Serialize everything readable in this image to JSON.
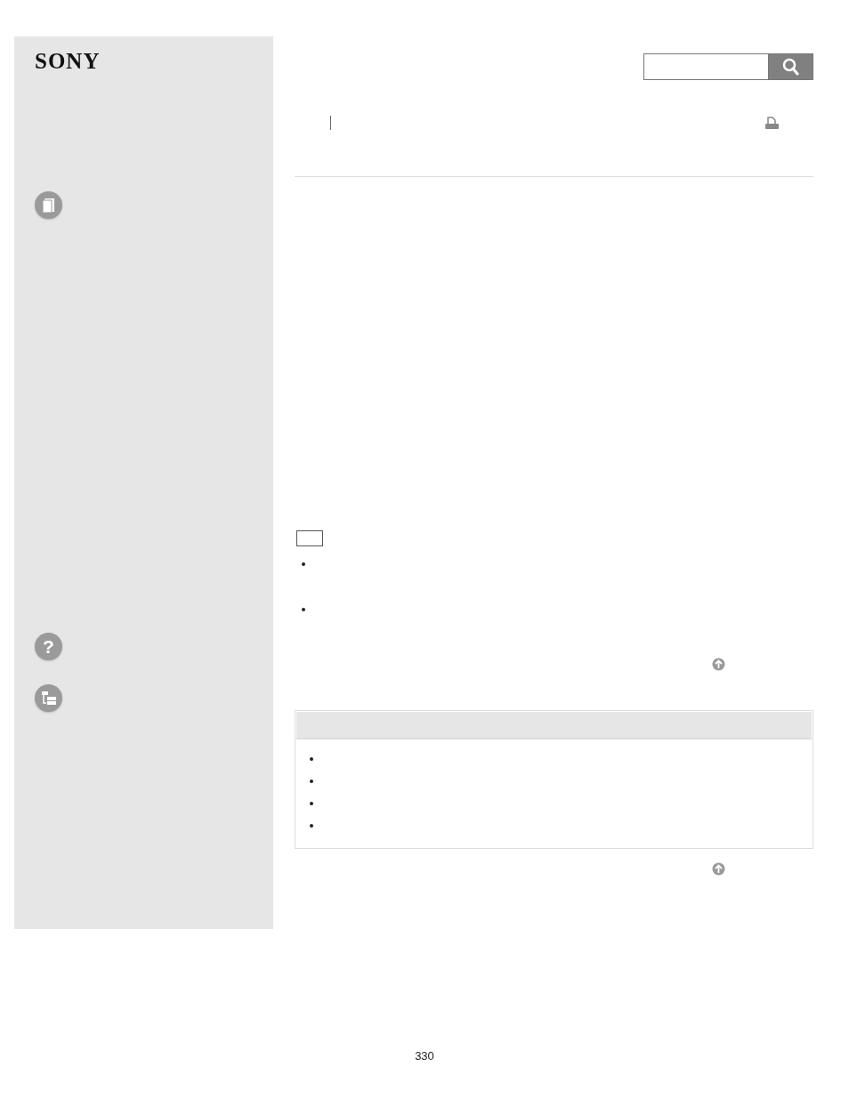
{
  "logo": {
    "text": "SONY"
  },
  "sidebar": {
    "help_icon_glyph": "?"
  },
  "footer": {
    "page_number": "330"
  }
}
